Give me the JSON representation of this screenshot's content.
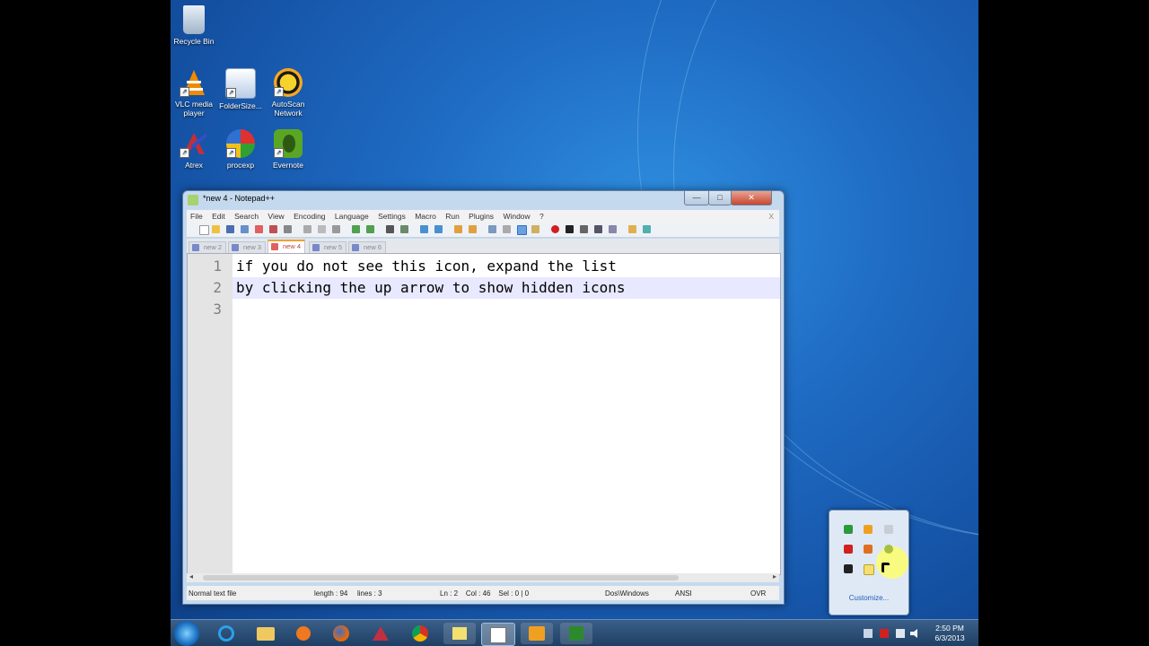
{
  "desktop": {
    "icons": [
      {
        "label": "Recycle Bin",
        "icon": "recycle-bin-icon"
      },
      {
        "label": "VLC media player",
        "icon": "vlc-icon"
      },
      {
        "label": "FolderSize...",
        "icon": "foldersize-icon"
      },
      {
        "label": "AutoScan Network",
        "icon": "autoscan-icon"
      },
      {
        "label": "Atrex",
        "icon": "atrex-icon"
      },
      {
        "label": "procexp",
        "icon": "procexp-icon"
      },
      {
        "label": "Evernote",
        "icon": "evernote-icon"
      }
    ]
  },
  "window": {
    "title": "*new 4 - Notepad++",
    "close_doc": "X"
  },
  "menu": [
    "File",
    "Edit",
    "Search",
    "View",
    "Encoding",
    "Language",
    "Settings",
    "Macro",
    "Run",
    "Plugins",
    "Window",
    "?"
  ],
  "tabs": [
    {
      "label": "new 2",
      "active": false
    },
    {
      "label": "new 3",
      "active": false
    },
    {
      "label": "new 4",
      "active": true
    },
    {
      "label": "new 5",
      "active": false
    },
    {
      "label": "new 6",
      "active": false
    }
  ],
  "editor": {
    "lines": [
      {
        "number": "1",
        "text": "if you do not see this icon, expand the list"
      },
      {
        "number": "2",
        "text": "by clicking the up arrow to show hidden icons"
      },
      {
        "number": "3",
        "text": ""
      }
    ]
  },
  "status": {
    "filetype": "Normal text file",
    "length": "length : 94",
    "lines": "lines : 3",
    "position": "Ln : 2    Col : 46    Sel : 0 | 0",
    "eol": "Dos\\Windows",
    "encoding": "ANSI",
    "mode": "OVR"
  },
  "tray_flyout": {
    "customize_label": "Customize..."
  },
  "taskbar": {
    "clock_time": "2:50 PM",
    "clock_date": "6/3/2013"
  },
  "colors": {
    "desktop_blue": "#1f6cc4",
    "active_tab_accent": "#f0a030",
    "current_line": "#e8e8ff"
  }
}
